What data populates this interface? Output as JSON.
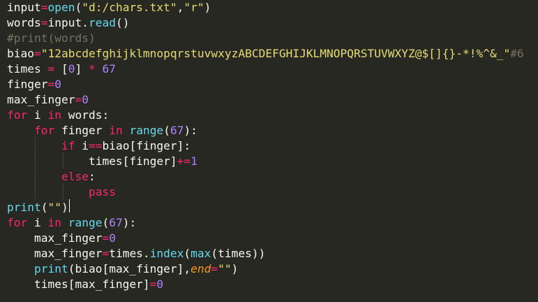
{
  "code": {
    "lines": [
      [
        {
          "t": "input",
          "s": "white"
        },
        {
          "t": "=",
          "s": "op"
        },
        {
          "t": "open",
          "s": "builtin"
        },
        {
          "t": "(",
          "s": "white"
        },
        {
          "t": "\"d:/chars.txt\"",
          "s": "str"
        },
        {
          "t": ",",
          "s": "white"
        },
        {
          "t": "\"r\"",
          "s": "str"
        },
        {
          "t": ")",
          "s": "white"
        }
      ],
      [
        {
          "t": "words",
          "s": "white"
        },
        {
          "t": "=",
          "s": "op"
        },
        {
          "t": "input",
          "s": "white"
        },
        {
          "t": ".",
          "s": "white"
        },
        {
          "t": "read",
          "s": "builtin"
        },
        {
          "t": "()",
          "s": "white"
        }
      ],
      [
        {
          "t": "#print(words)",
          "s": "comment"
        }
      ],
      [
        {
          "t": "biao",
          "s": "white"
        },
        {
          "t": "=",
          "s": "op"
        },
        {
          "t": "\"12abcdefghijklmnopqrstuvwxyzABCDEFGHIJKLMNOPQRSTUVWXYZ@$[]{}-*!%^&_\"",
          "s": "str"
        },
        {
          "t": "#6",
          "s": "comment"
        }
      ],
      [
        {
          "t": "times ",
          "s": "white"
        },
        {
          "t": "=",
          "s": "op"
        },
        {
          "t": " [",
          "s": "white"
        },
        {
          "t": "0",
          "s": "num"
        },
        {
          "t": "] ",
          "s": "white"
        },
        {
          "t": "*",
          "s": "op"
        },
        {
          "t": " ",
          "s": "white"
        },
        {
          "t": "67",
          "s": "num"
        }
      ],
      [
        {
          "t": "finger",
          "s": "white"
        },
        {
          "t": "=",
          "s": "op"
        },
        {
          "t": "0",
          "s": "num"
        }
      ],
      [
        {
          "t": "max_finger",
          "s": "white"
        },
        {
          "t": "=",
          "s": "op"
        },
        {
          "t": "0",
          "s": "num"
        }
      ],
      [
        {
          "t": "for",
          "s": "kw"
        },
        {
          "t": " i ",
          "s": "white"
        },
        {
          "t": "in",
          "s": "kw"
        },
        {
          "t": " words:",
          "s": "white"
        }
      ],
      [
        {
          "t": "    ",
          "s": "white"
        },
        {
          "t": "for",
          "s": "kw"
        },
        {
          "t": " finger ",
          "s": "white"
        },
        {
          "t": "in",
          "s": "kw"
        },
        {
          "t": " ",
          "s": "white"
        },
        {
          "t": "range",
          "s": "builtin"
        },
        {
          "t": "(",
          "s": "white"
        },
        {
          "t": "67",
          "s": "num"
        },
        {
          "t": "):",
          "s": "white"
        }
      ],
      [
        {
          "t": "        ",
          "s": "white"
        },
        {
          "t": "if",
          "s": "kw"
        },
        {
          "t": " i",
          "s": "white"
        },
        {
          "t": "==",
          "s": "op"
        },
        {
          "t": "biao[finger]:",
          "s": "white"
        }
      ],
      [
        {
          "t": "            ",
          "s": "white"
        },
        {
          "t": "times[finger]",
          "s": "white"
        },
        {
          "t": "+=",
          "s": "op"
        },
        {
          "t": "1",
          "s": "num"
        }
      ],
      [
        {
          "t": "        ",
          "s": "white"
        },
        {
          "t": "else",
          "s": "kw"
        },
        {
          "t": ":",
          "s": "white"
        }
      ],
      [
        {
          "t": "            ",
          "s": "white"
        },
        {
          "t": "pass",
          "s": "kw"
        }
      ],
      [
        {
          "t": "print",
          "s": "builtin"
        },
        {
          "t": "(",
          "s": "white"
        },
        {
          "t": "\"\"",
          "s": "str"
        },
        {
          "t": ")",
          "s": "white"
        }
      ],
      [
        {
          "t": "for",
          "s": "kw"
        },
        {
          "t": " i ",
          "s": "white"
        },
        {
          "t": "in",
          "s": "kw"
        },
        {
          "t": " ",
          "s": "white"
        },
        {
          "t": "range",
          "s": "builtin"
        },
        {
          "t": "(",
          "s": "white"
        },
        {
          "t": "67",
          "s": "num"
        },
        {
          "t": "):",
          "s": "white"
        }
      ],
      [
        {
          "t": "    ",
          "s": "white"
        },
        {
          "t": "max_finger",
          "s": "white"
        },
        {
          "t": "=",
          "s": "op"
        },
        {
          "t": "0",
          "s": "num"
        }
      ],
      [
        {
          "t": "    ",
          "s": "white"
        },
        {
          "t": "max_finger",
          "s": "white"
        },
        {
          "t": "=",
          "s": "op"
        },
        {
          "t": "times.",
          "s": "white"
        },
        {
          "t": "index",
          "s": "builtin"
        },
        {
          "t": "(",
          "s": "white"
        },
        {
          "t": "max",
          "s": "builtin"
        },
        {
          "t": "(times))",
          "s": "white"
        }
      ],
      [
        {
          "t": "    ",
          "s": "white"
        },
        {
          "t": "print",
          "s": "builtin"
        },
        {
          "t": "(biao[max_finger],",
          "s": "white"
        },
        {
          "t": "end",
          "s": "param"
        },
        {
          "t": "=",
          "s": "op"
        },
        {
          "t": "\"\"",
          "s": "str"
        },
        {
          "t": ")",
          "s": "white"
        }
      ],
      [
        {
          "t": "    ",
          "s": "white"
        },
        {
          "t": "times[max_finger]",
          "s": "white"
        },
        {
          "t": "=",
          "s": "op"
        },
        {
          "t": "0",
          "s": "num"
        }
      ]
    ]
  },
  "colors": {
    "background": "#272822",
    "text": "#f8f8f2",
    "keyword": "#f92672",
    "builtin": "#66d9ef",
    "string": "#e6db74",
    "number": "#ae81ff",
    "comment": "#75715e",
    "parameter": "#fd971f"
  }
}
